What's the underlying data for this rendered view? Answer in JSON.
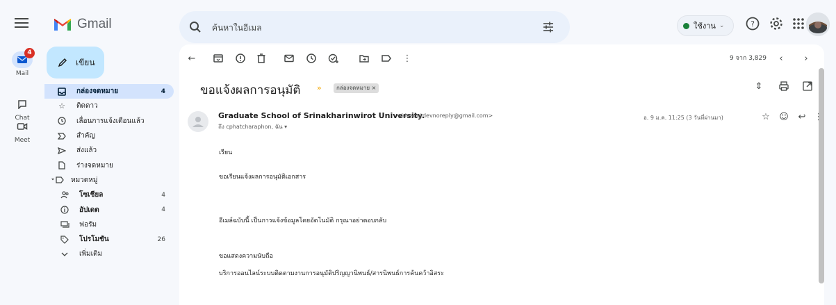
{
  "app": {
    "name": "Gmail"
  },
  "search": {
    "placeholder": "ค้นหาในอีเมล"
  },
  "status": {
    "label": "ใช้งาน"
  },
  "rail": [
    {
      "label": "Mail",
      "badge": "4"
    },
    {
      "label": "Chat"
    },
    {
      "label": "Meet"
    }
  ],
  "compose": {
    "label": "เขียน"
  },
  "nav": {
    "inbox": {
      "label": "กล่องจดหมาย",
      "count": "4"
    },
    "starred": {
      "label": "ติดดาว"
    },
    "snoozed": {
      "label": "เลื่อนการแจ้งเตือนแล้ว"
    },
    "important": {
      "label": "สำคัญ"
    },
    "sent": {
      "label": "ส่งแล้ว"
    },
    "drafts": {
      "label": "ร่างจดหมาย"
    },
    "categories": {
      "label": "หมวดหมู่"
    },
    "social": {
      "label": "โซเชียล",
      "count": "4"
    },
    "updates": {
      "label": "อัปเดต",
      "count": "4"
    },
    "forums": {
      "label": "ฟอรัม"
    },
    "promotions": {
      "label": "โปรโมชัน",
      "count": "26"
    },
    "more": {
      "label": "เพิ่มเติม"
    }
  },
  "pager": {
    "text": "9 จาก 3,829"
  },
  "email": {
    "subject": "ขอแจ้งผลการอนุมัติ",
    "label_chip": "กล่องจดหมาย ×",
    "sender_name": "Graduate School of Srinakharinwirot University.",
    "sender_email": "<ideadotdevnoreply@gmail.com>",
    "to_line": "ถึง cphatcharaphon, ฉัน ▾",
    "date": "อ. 9 ม.ค. 11:25 (3 วันที่ผ่านมา)",
    "body": {
      "greeting": "เรียน",
      "line1": "ขอเรียนแจ้งผลการอนุมัติเอกสาร",
      "line2": "อีเมล์ฉบับนี้ เป็นการแจ้งข้อมูลโดยอัตโนมัติ กรุณาอย่าตอบกลับ",
      "line3": "ขอแสดงความนับถือ",
      "line4": "บริการออนไลน์ระบบติดตามงานการอนุมัติปริญญานิพนธ์/สารนิพนธ์การค้นคว้าอิสระ"
    }
  },
  "colors": {
    "accent": "#0b57d0",
    "compose_bg": "#c2e7ff",
    "active_nav": "#d3e3fd",
    "badge": "#d93025",
    "status": "#188038"
  }
}
